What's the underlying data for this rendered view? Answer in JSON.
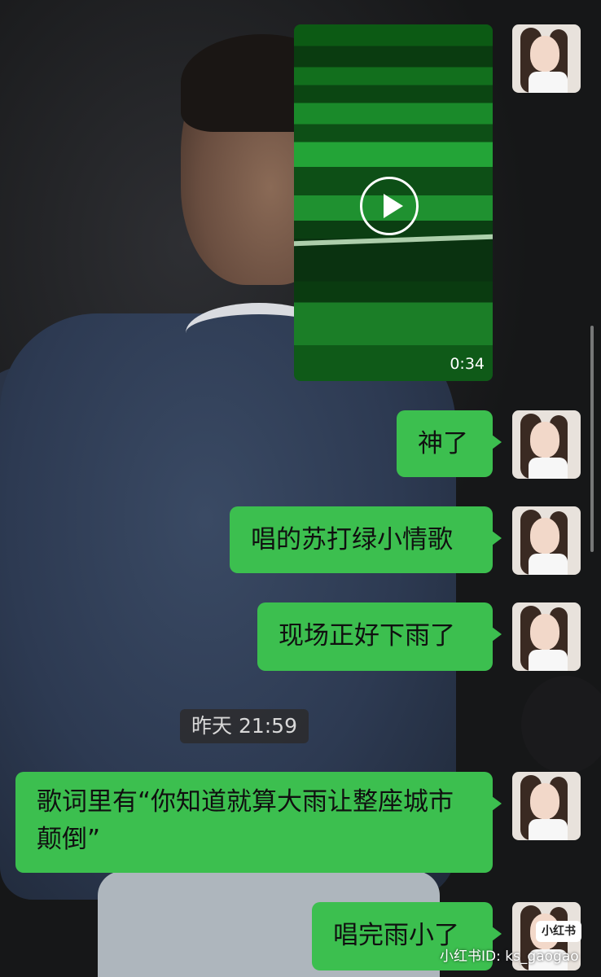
{
  "video": {
    "duration": "0:34"
  },
  "messages": [
    {
      "text": "神了"
    },
    {
      "text": "唱的苏打绿小情歌"
    },
    {
      "text": "现场正好下雨了"
    },
    {
      "text": "歌词里有“你知道就算大雨让整座城市颠倒”"
    },
    {
      "text": "唱完雨小了"
    }
  ],
  "timestamp": "昨天 21:59",
  "watermark": {
    "logo": "小红书",
    "id": "小红书ID: ks_gaogao"
  },
  "colors": {
    "bubble": "#3cbf4f",
    "background": "#1b1c1e"
  }
}
